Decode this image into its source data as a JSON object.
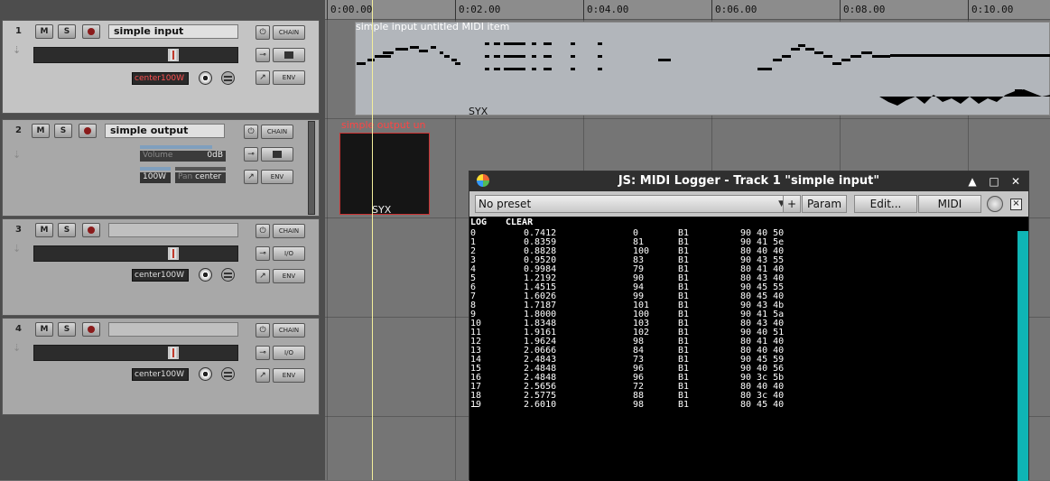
{
  "tracks": [
    {
      "num": "1",
      "name": "simple input",
      "pan": "center",
      "vol": "100W",
      "fx_label": "CHAIN",
      "io_label": "",
      "env_label": "ENV",
      "selected": true
    },
    {
      "num": "2",
      "name": "simple output",
      "volume_label": "Volume",
      "volume_value": "0dB",
      "width": "100W",
      "pan_label": "Pan",
      "pan_value": "center",
      "fx_label": "CHAIN",
      "env_label": "ENV"
    },
    {
      "num": "3",
      "name": "",
      "pan": "center",
      "vol": "100W",
      "fx_label": "CHAIN",
      "io_label": "I/O",
      "env_label": "ENV"
    },
    {
      "num": "4",
      "name": "",
      "pan": "center",
      "vol": "100W",
      "fx_label": "CHAIN",
      "io_label": "I/O",
      "env_label": "ENV"
    }
  ],
  "buttons": {
    "mute": "M",
    "solo": "S"
  },
  "ruler": {
    "marks": [
      "0:00.00",
      "0:02.00",
      "0:04.00",
      "0:06.00",
      "0:08.00",
      "0:10.00"
    ]
  },
  "items": {
    "item1_label": "simple input untitled MIDI item",
    "item1_syx": "SYX",
    "item2_label": "simple output un",
    "item2_syx": "SYX"
  },
  "window": {
    "title": "JS: MIDI Logger - Track 1 \"simple input\"",
    "preset": "No preset",
    "plus_label": "+",
    "param_label": "Param",
    "edit_label": "Edit...",
    "midi_label": "MIDI",
    "bypass_label": "×",
    "log_label": "LOG",
    "clear_label": "CLEAR",
    "rows": [
      [
        "0",
        "0.7412",
        "0",
        "B1",
        "90 40 50"
      ],
      [
        "1",
        "0.8359",
        "81",
        "B1",
        "90 41 5e"
      ],
      [
        "2",
        "0.8828",
        "100",
        "B1",
        "80 40 40"
      ],
      [
        "3",
        "0.9520",
        "83",
        "B1",
        "90 43 55"
      ],
      [
        "4",
        "0.9984",
        "79",
        "B1",
        "80 41 40"
      ],
      [
        "5",
        "1.2192",
        "90",
        "B1",
        "80 43 40"
      ],
      [
        "6",
        "1.4515",
        "94",
        "B1",
        "90 45 55"
      ],
      [
        "7",
        "1.6026",
        "99",
        "B1",
        "80 45 40"
      ],
      [
        "8",
        "1.7187",
        "101",
        "B1",
        "90 43 4b"
      ],
      [
        "9",
        "1.8000",
        "100",
        "B1",
        "90 41 5a"
      ],
      [
        "10",
        "1.8348",
        "103",
        "B1",
        "80 43 40"
      ],
      [
        "11",
        "1.9161",
        "102",
        "B1",
        "90 40 51"
      ],
      [
        "12",
        "1.9624",
        "98",
        "B1",
        "80 41 40"
      ],
      [
        "13",
        "2.0666",
        "84",
        "B1",
        "80 40 40"
      ],
      [
        "14",
        "2.4843",
        "73",
        "B1",
        "90 45 59"
      ],
      [
        "15",
        "2.4848",
        "96",
        "B1",
        "90 40 56"
      ],
      [
        "16",
        "2.4848",
        "96",
        "B1",
        "90 3c 5b"
      ],
      [
        "17",
        "2.5656",
        "72",
        "B1",
        "80 40 40"
      ],
      [
        "18",
        "2.5775",
        "88",
        "B1",
        "80 3c 40"
      ],
      [
        "19",
        "2.6010",
        "98",
        "B1",
        "80 45 40"
      ]
    ]
  }
}
